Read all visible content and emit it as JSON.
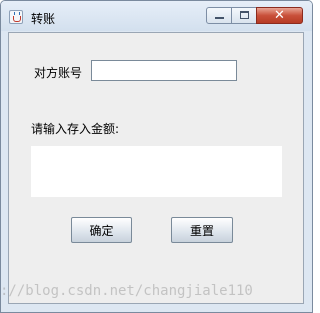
{
  "window": {
    "title": "转账",
    "app_icon": "java-cup-icon",
    "controls": {
      "minimize_icon": "minimize-icon",
      "maximize_icon": "maximize-icon",
      "close_icon": "close-icon",
      "close_glyph": "✕"
    }
  },
  "form": {
    "account_label": "对方账号",
    "account_value": "",
    "amount_label": "请输入存入金额:",
    "amount_value": "",
    "confirm_label": "确定",
    "reset_label": "重置"
  },
  "watermark": "://blog.csdn.net/changjiale110",
  "colors": {
    "close_button": "#c9503a",
    "content_background": "#eeeeee",
    "title_bar": "#dde7f2"
  }
}
